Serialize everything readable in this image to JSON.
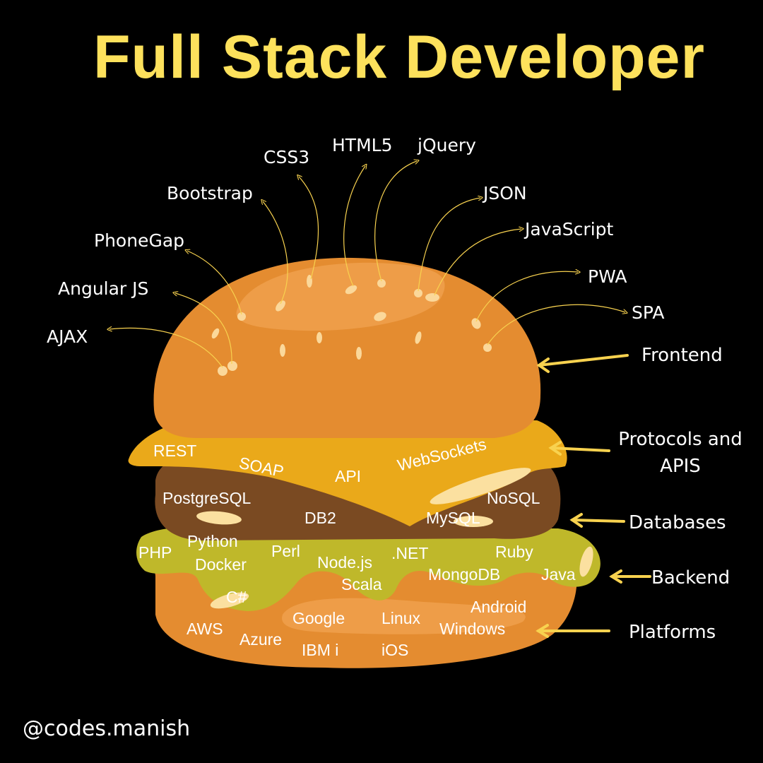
{
  "title": "Full Stack Developer",
  "handle": "@codes.manish",
  "colors": {
    "background": "#000000",
    "title": "#fde15c",
    "bun": "#e48c30",
    "bun_highlight": "#ee9d48",
    "cheese": "#eaa91a",
    "patty": "#7a4a22",
    "lettuce": "#bfb82a",
    "arrow": "#f8d24f",
    "text": "#ffffff"
  },
  "frontend_tools": [
    "AJAX",
    "Angular JS",
    "PhoneGap",
    "Bootstrap",
    "CSS3",
    "HTML5",
    "jQuery",
    "JSON",
    "JavaScript",
    "PWA",
    "SPA"
  ],
  "layers": [
    {
      "category": "Frontend",
      "items": []
    },
    {
      "category": "Protocols and APIS",
      "items": [
        "REST",
        "SOAP",
        "API",
        "WebSockets"
      ]
    },
    {
      "category": "Databases",
      "items": [
        "PostgreSQL",
        "DB2",
        "MySQL",
        "NoSQL"
      ]
    },
    {
      "category": "Backend",
      "items": [
        "PHP",
        "Python",
        "Docker",
        "Perl",
        "Node.js",
        ".NET",
        "Ruby",
        "Scala",
        "MongoDB",
        "Java",
        "C#"
      ]
    },
    {
      "category": "Platforms",
      "items": [
        "AWS",
        "Azure",
        "Google",
        "IBM i",
        "Linux",
        "iOS",
        "Android",
        "Windows"
      ]
    }
  ],
  "category_labels": {
    "frontend": "Frontend",
    "protocols_line1": "Protocols and",
    "protocols_line2": "APIS",
    "databases": "Databases",
    "backend": "Backend",
    "platforms": "Platforms"
  }
}
